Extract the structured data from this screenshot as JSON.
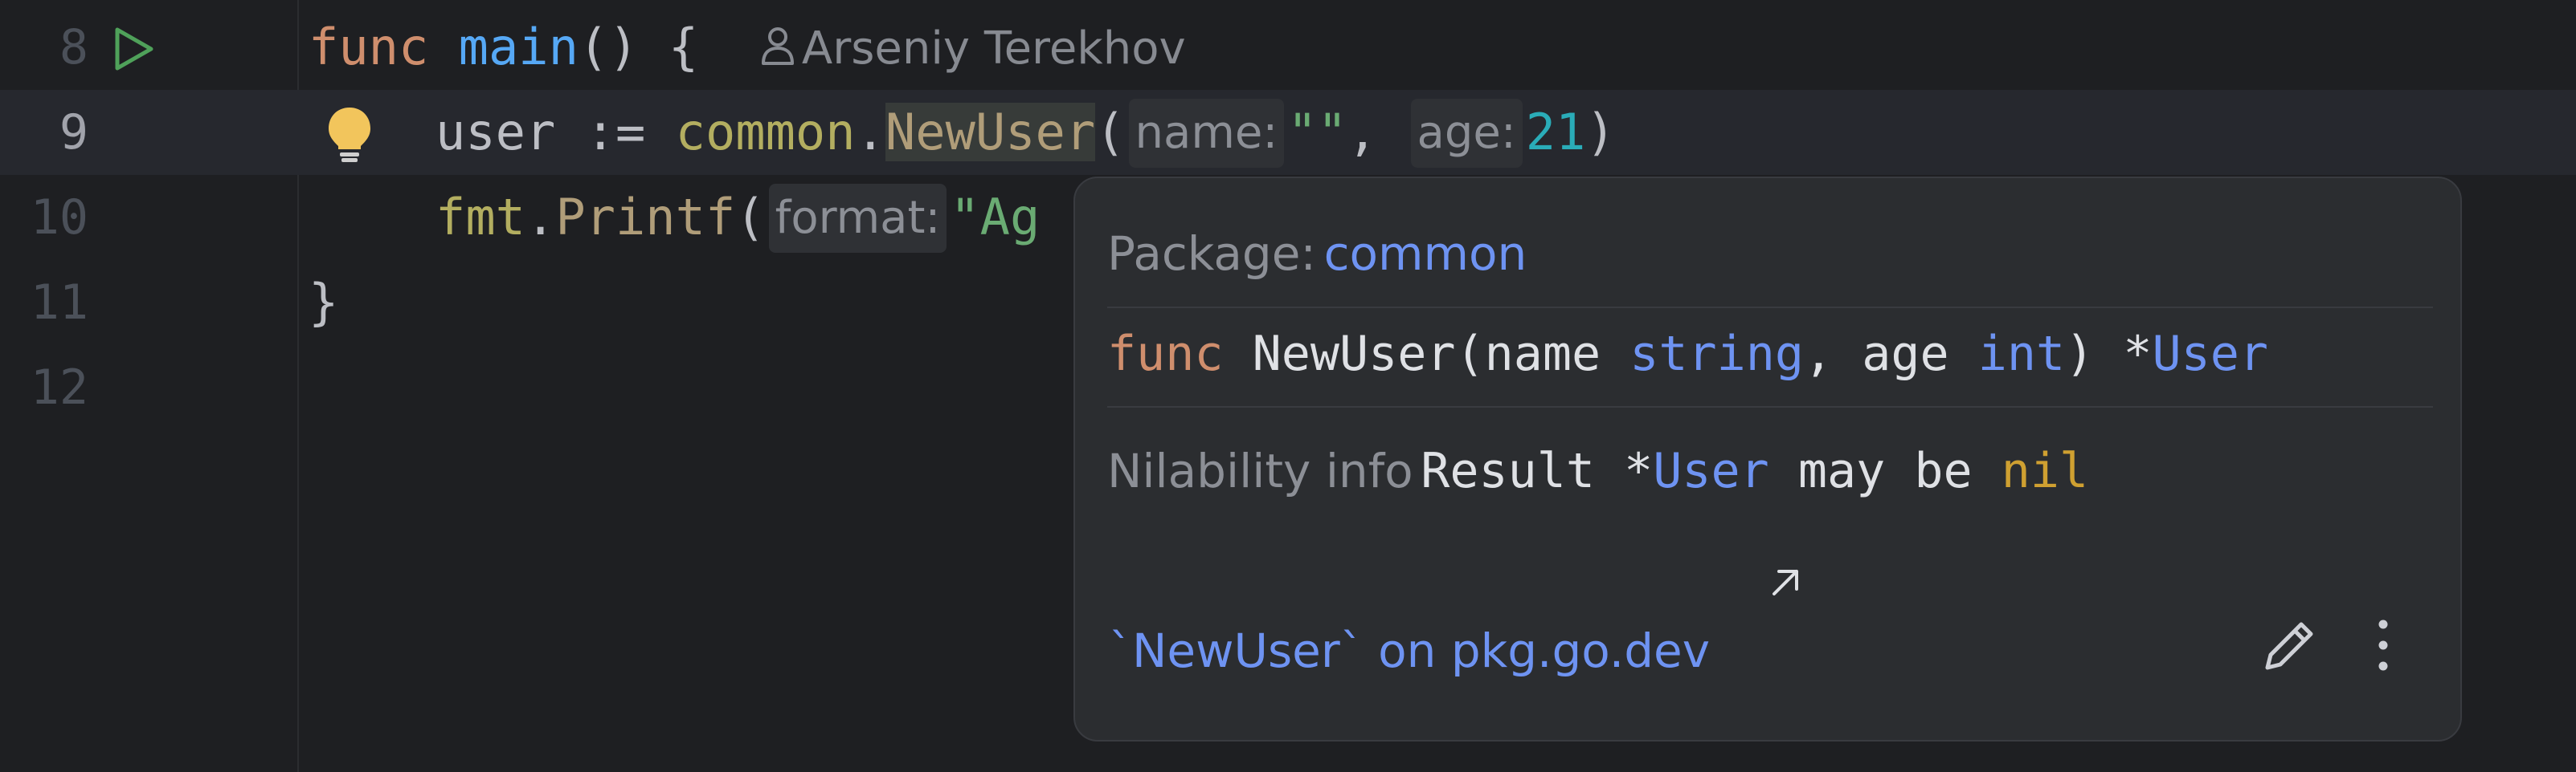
{
  "editor": {
    "lines": [
      {
        "number": "8",
        "keyword": "func",
        "fn_name": "main",
        "rest": "() {",
        "author": "Arseniy Terekhov"
      },
      {
        "number": "9",
        "var": "user := ",
        "pkg": "common",
        "dot": ".",
        "method": "NewUser",
        "open": "(",
        "hint_name": "name:",
        "str_val": "\"\"",
        "comma": ",",
        "hint_age": "age:",
        "num_val": "21",
        "close": ")"
      },
      {
        "number": "10",
        "pkg": "fmt",
        "dot": ".",
        "method": "Printf",
        "open": "(",
        "hint_format": "format:",
        "str_val": "\"Ag"
      },
      {
        "number": "11",
        "text": "}"
      },
      {
        "number": "12"
      }
    ]
  },
  "popup": {
    "package_label": "Package:",
    "package_name": "common",
    "signature": {
      "kw": "func",
      "name": " NewUser(name ",
      "type1": "string",
      "mid": ", age ",
      "type2": "int",
      "close": ") *",
      "ret": "User"
    },
    "nilability": {
      "label": "Nilability info",
      "text1": "Result *",
      "type": "User",
      "text2": " may be ",
      "nil": "nil"
    },
    "docs_link": "`NewUser` on pkg.go.dev"
  },
  "icons": {
    "run": "run-gutter-icon",
    "bulb": "intention-bulb-icon",
    "author": "person-icon",
    "external": "external-link-arrow-icon",
    "edit": "pencil-icon",
    "more": "more-vertical-icon"
  },
  "colors": {
    "background": "#1e1f22",
    "keyword": "#cf8e6d",
    "function": "#56a8f5",
    "string": "#6aab73",
    "number": "#2aacb8",
    "link": "#6e93f2",
    "run": "#4fa15a",
    "bulb": "#f2c55c"
  }
}
